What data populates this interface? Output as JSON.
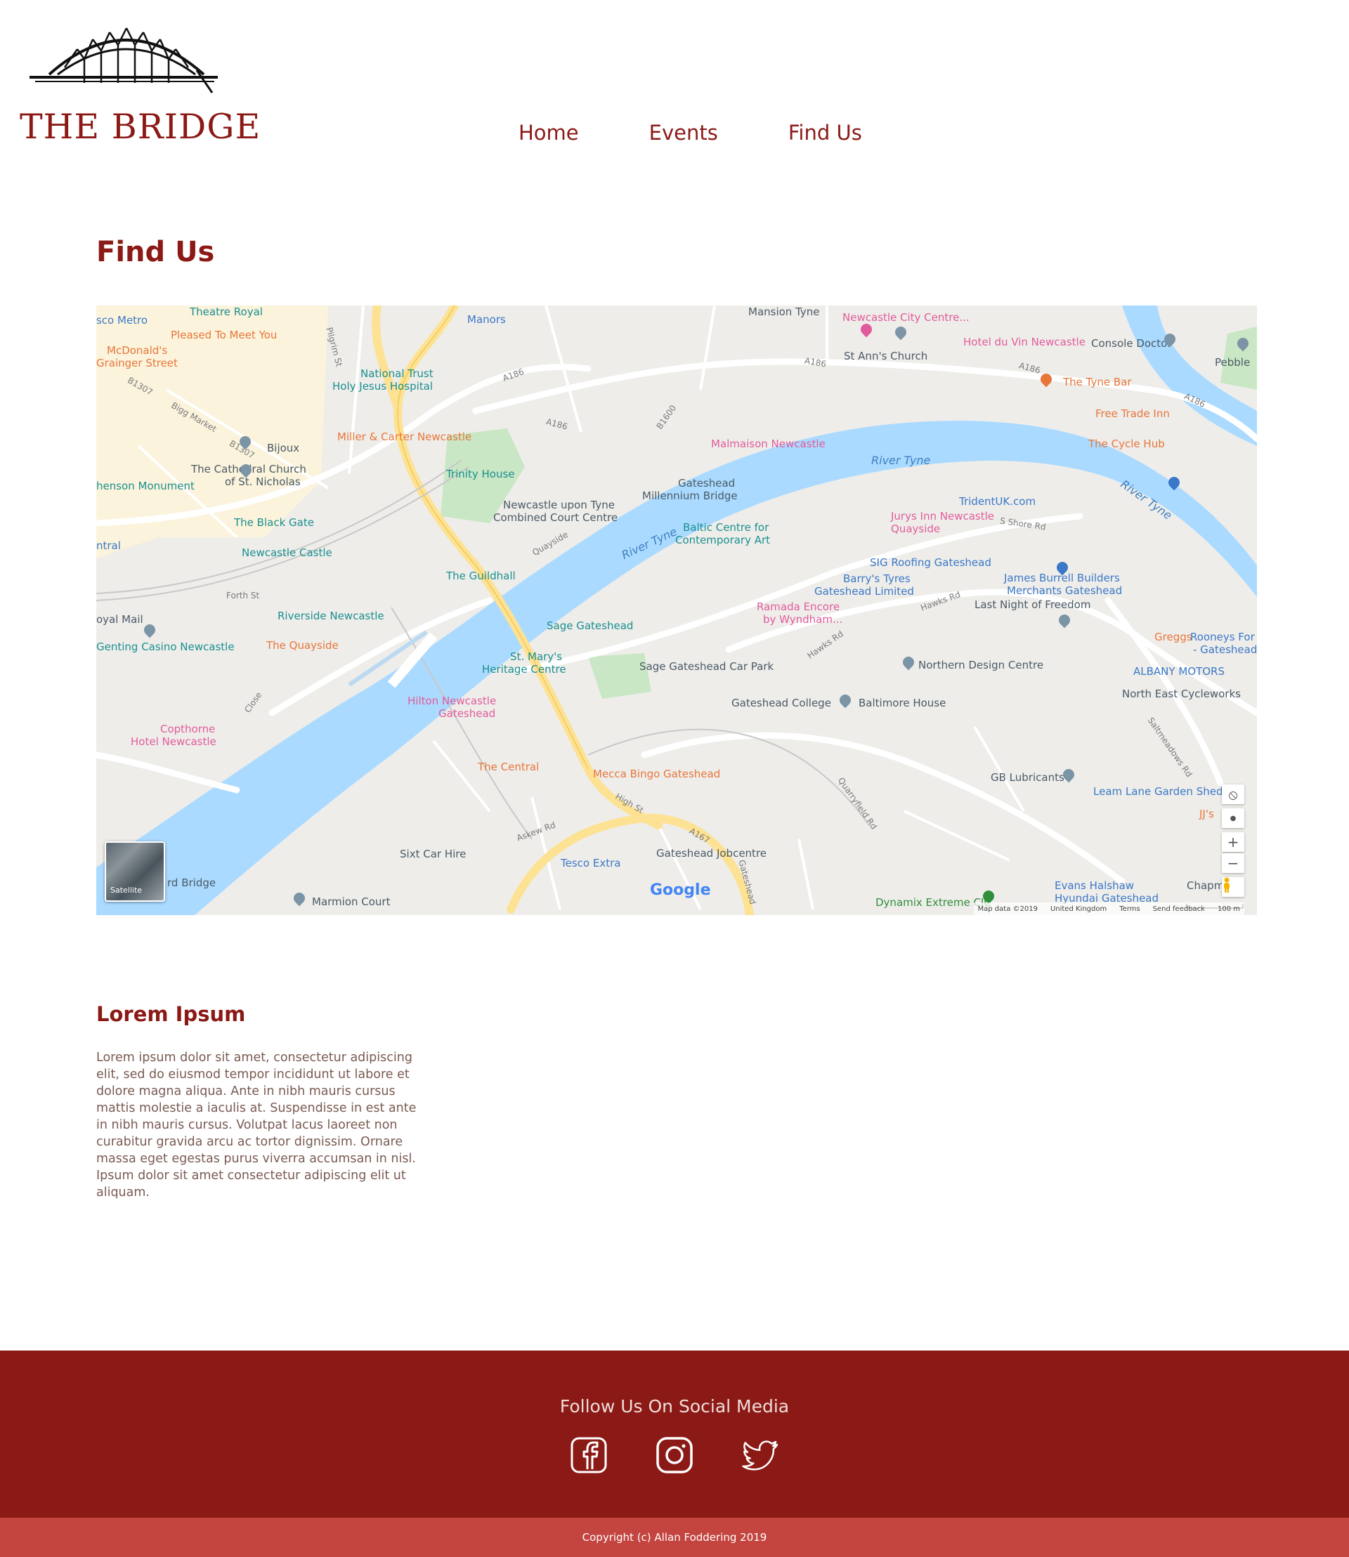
{
  "site": {
    "name": "THE BRIDGE"
  },
  "nav": {
    "items": [
      "Home",
      "Events",
      "Find Us"
    ]
  },
  "page": {
    "title": "Find Us"
  },
  "map": {
    "labels": [
      {
        "text": "Theatre Royal",
        "style": "teal"
      },
      {
        "text": "sco Metro",
        "style": "blue"
      },
      {
        "text": "Pleased To Meet You",
        "style": "orange"
      },
      {
        "text": "McDonald's",
        "style": "orange"
      },
      {
        "text": "Grainger Street",
        "style": "orange"
      },
      {
        "text": "Manors",
        "style": "blue"
      },
      {
        "text": "Mansion Tyne",
        "style": "poi"
      },
      {
        "text": "Newcastle City Centre...",
        "style": "pink"
      },
      {
        "text": "St Ann's Church",
        "style": "poi"
      },
      {
        "text": "Hotel du Vin Newcastle",
        "style": "pink"
      },
      {
        "text": "Console Doctor",
        "style": "poi"
      },
      {
        "text": "Pebble",
        "style": "poi"
      },
      {
        "text": "National Trust",
        "style": "teal"
      },
      {
        "text": "Holy Jesus Hospital",
        "style": "teal"
      },
      {
        "text": "The Tyne Bar",
        "style": "orange"
      },
      {
        "text": "Free Trade Inn",
        "style": "orange"
      },
      {
        "text": "The Cycle Hub",
        "style": "orange"
      },
      {
        "text": "Miller & Carter Newcastle",
        "style": "orange"
      },
      {
        "text": "Bijoux",
        "style": "poi"
      },
      {
        "text": "Malmaison Newcastle",
        "style": "pink"
      },
      {
        "text": "River Tyne",
        "style": "water"
      },
      {
        "text": "The Cathedral Church",
        "style": "poi"
      },
      {
        "text": "of St. Nicholas",
        "style": "poi"
      },
      {
        "text": "Trinity House",
        "style": "teal"
      },
      {
        "text": "Gateshead",
        "style": "poi"
      },
      {
        "text": "Millennium Bridge",
        "style": "poi"
      },
      {
        "text": "henson Monument",
        "style": "teal"
      },
      {
        "text": "TridentUK.com",
        "style": "blue"
      },
      {
        "text": "River Tyne",
        "style": "water"
      },
      {
        "text": "Newcastle upon Tyne",
        "style": "poi"
      },
      {
        "text": "Combined Court Centre",
        "style": "poi"
      },
      {
        "text": "Jurys Inn Newcastle",
        "style": "pink"
      },
      {
        "text": "Quayside",
        "style": "pink"
      },
      {
        "text": "The Black Gate",
        "style": "teal"
      },
      {
        "text": "Baltic Centre for",
        "style": "teal"
      },
      {
        "text": "Contemporary Art",
        "style": "teal"
      },
      {
        "text": "ntral",
        "style": "blue"
      },
      {
        "text": "Newcastle Castle",
        "style": "teal"
      },
      {
        "text": "River Tyne",
        "style": "water"
      },
      {
        "text": "SIG Roofing Gateshead",
        "style": "blue"
      },
      {
        "text": "The Guildhall",
        "style": "teal"
      },
      {
        "text": "Barry's Tyres",
        "style": "blue"
      },
      {
        "text": "Gateshead Limited",
        "style": "blue"
      },
      {
        "text": "James Burrell Builders",
        "style": "blue"
      },
      {
        "text": "Merchants Gateshead",
        "style": "blue"
      },
      {
        "text": "Last Night of Freedom",
        "style": "poi"
      },
      {
        "text": "oyal Mail",
        "style": "poi"
      },
      {
        "text": "Riverside Newcastle",
        "style": "teal"
      },
      {
        "text": "Ramada Encore",
        "style": "pink"
      },
      {
        "text": "by Wyndham...",
        "style": "pink"
      },
      {
        "text": "Sage Gateshead",
        "style": "teal"
      },
      {
        "text": "Greggs",
        "style": "orange"
      },
      {
        "text": "Rooneys For R",
        "style": "blue"
      },
      {
        "text": "- Gateshead -",
        "style": "blue"
      },
      {
        "text": "Genting Casino Newcastle",
        "style": "teal"
      },
      {
        "text": "The Quayside",
        "style": "orange"
      },
      {
        "text": "St. Mary's",
        "style": "teal"
      },
      {
        "text": "Heritage Centre",
        "style": "teal"
      },
      {
        "text": "Sage Gateshead Car Park",
        "style": "poi"
      },
      {
        "text": "Northern Design Centre",
        "style": "poi"
      },
      {
        "text": "ALBANY MOTORS",
        "style": "blue"
      },
      {
        "text": "North East Cycleworks",
        "style": "poi"
      },
      {
        "text": "Hilton Newcastle",
        "style": "pink"
      },
      {
        "text": "Gateshead",
        "style": "pink"
      },
      {
        "text": "Gateshead College",
        "style": "poi"
      },
      {
        "text": "Baltimore House",
        "style": "poi"
      },
      {
        "text": "Copthorne",
        "style": "pink"
      },
      {
        "text": "Hotel Newcastle",
        "style": "pink"
      },
      {
        "text": "The Central",
        "style": "orange"
      },
      {
        "text": "Mecca Bingo Gateshead",
        "style": "orange"
      },
      {
        "text": "GB Lubricants",
        "style": "poi"
      },
      {
        "text": "Leam Lane Garden Sheds",
        "style": "blue"
      },
      {
        "text": "JJ's",
        "style": "orange"
      },
      {
        "text": "Sixt Car Hire",
        "style": "poi"
      },
      {
        "text": "Gateshead Jobcentre",
        "style": "poi"
      },
      {
        "text": "Tesco Extra",
        "style": "blue"
      },
      {
        "text": "rd Bridge",
        "style": "poi"
      },
      {
        "text": "Marmion Court",
        "style": "poi"
      },
      {
        "text": "Dynamix Extreme CIC",
        "style": "green"
      },
      {
        "text": "Evans Halshaw",
        "style": "blue"
      },
      {
        "text": "Hyundai Gateshead",
        "style": "blue"
      },
      {
        "text": "Chapm",
        "style": "poi"
      },
      {
        "text": "A186",
        "style": "road"
      },
      {
        "text": "A186",
        "style": "road"
      },
      {
        "text": "A186",
        "style": "road"
      },
      {
        "text": "A186",
        "style": "road"
      },
      {
        "text": "A186",
        "style": "road"
      },
      {
        "text": "B1307",
        "style": "road"
      },
      {
        "text": "B1307",
        "style": "road"
      },
      {
        "text": "Bigg Market",
        "style": "road"
      },
      {
        "text": "Pilgrim St",
        "style": "road"
      },
      {
        "text": "Quayside",
        "style": "road"
      },
      {
        "text": "Hawks Rd",
        "style": "road"
      },
      {
        "text": "Hawks Rd",
        "style": "road"
      },
      {
        "text": "High St",
        "style": "road"
      },
      {
        "text": "A167",
        "style": "road"
      },
      {
        "text": "Askew Rd",
        "style": "road"
      },
      {
        "text": "Gateshead",
        "style": "road"
      },
      {
        "text": "Saltmeadows Rd",
        "style": "road"
      },
      {
        "text": "Quarryfield Rd",
        "style": "road"
      },
      {
        "text": "B1600",
        "style": "road"
      },
      {
        "text": "S Shore Rd",
        "style": "road"
      },
      {
        "text": "Forth St",
        "style": "road"
      },
      {
        "text": "Close",
        "style": "road"
      }
    ],
    "satellite_label": "Satellite",
    "google_logo": "Google",
    "attribution": [
      "Map data ©2019",
      "United Kingdom",
      "Terms",
      "Send feedback",
      "100 m"
    ],
    "controls": [
      "⦸",
      "●",
      "+",
      "−"
    ]
  },
  "content": {
    "title": "Lorem Ipsum",
    "body": "Lorem ipsum dolor sit amet, consectetur adipiscing elit, sed do eiusmod tempor incididunt ut labore et dolore magna aliqua. Ante in nibh mauris cursus mattis molestie a iaculis at. Suspendisse in est ante in nibh mauris cursus. Volutpat lacus laoreet non curabitur gravida arcu ac tortor dignissim. Ornare massa eget egestas purus viverra accumsan in nisl. Ipsum dolor sit amet consectetur adipiscing elit ut aliquam."
  },
  "footer": {
    "title": "Follow Us On Social Media",
    "socials": [
      "facebook-icon",
      "instagram-icon",
      "twitter-icon"
    ],
    "copyright": "Copyright (c) Allan Foddering 2019"
  },
  "colors": {
    "brand": "#8b1a16",
    "footer_bar": "#c4443f",
    "water": "#aadaff",
    "land": "#eeedea",
    "road_major": "#fde293"
  }
}
